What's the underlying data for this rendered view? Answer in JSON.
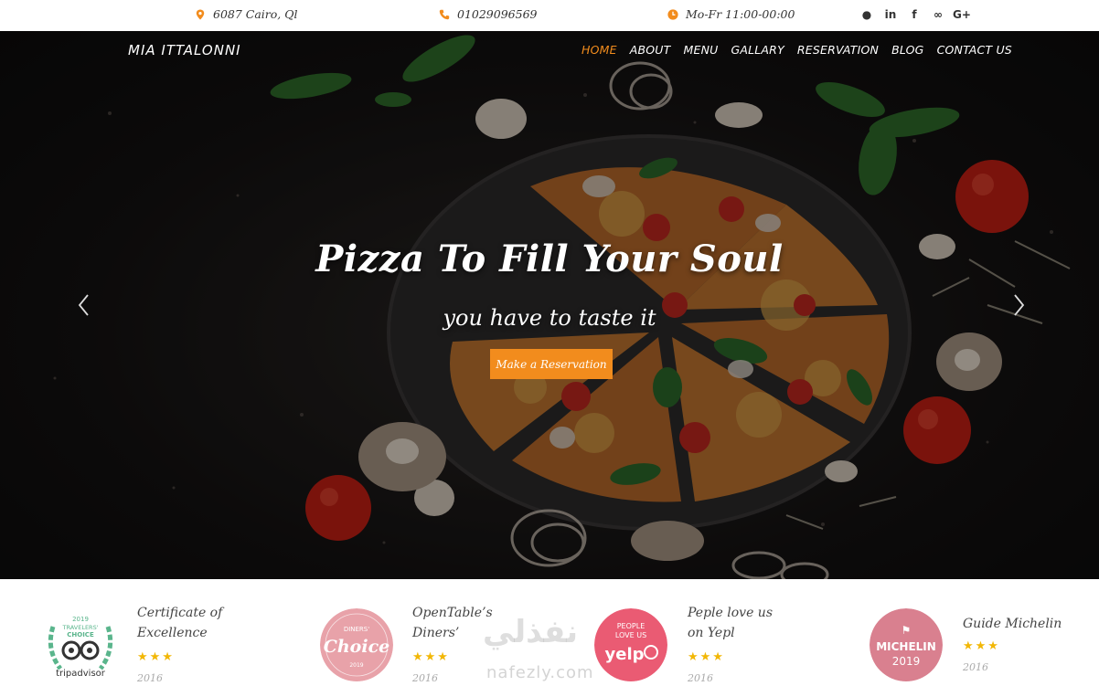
{
  "topbar": {
    "address": "6087 Cairo, Ql",
    "phone": "01029096569",
    "hours": "Mo-Fr 11:00-00:00",
    "socials": [
      "github-icon",
      "linkedin-icon",
      "facebook-icon",
      "tripadvisor-icon",
      "google-plus-icon"
    ],
    "social_glyphs": [
      "●",
      "in",
      "f",
      "∞",
      "G+"
    ],
    "icon_color": "#f28c1d"
  },
  "nav": {
    "brand": "MIA ITTALONNI",
    "items": [
      "HOME",
      "ABOUT",
      "MENU",
      "GALLARY",
      "RESERVATION",
      "BLOG",
      "CONTACT US"
    ],
    "active": "HOME",
    "active_color": "#f28c1d"
  },
  "hero": {
    "title": "Pizza To Fill Your Soul",
    "subtitle": "you have to taste it",
    "button": "Make a Reservation",
    "prev_arrow": "‹",
    "next_arrow": "›"
  },
  "awards": [
    {
      "title": "Certificate of Excellence",
      "badge": "tripadvisor-travelers-choice-badge",
      "badge_text": "tripadvisor",
      "stars": "★★★",
      "year": "2016"
    },
    {
      "title": "OpenTable’s Diners’",
      "badge": "diners-choice-badge",
      "badge_text": "Choice",
      "stars": "★★★",
      "year": "2016"
    },
    {
      "title": "Peple love us on Yepl",
      "badge": "yelp-badge",
      "badge_text": "yelp",
      "stars": "★★★",
      "year": "2016"
    },
    {
      "title": "Guide Michelin",
      "badge": "michelin-badge",
      "badge_text": "MICHELIN 2019",
      "stars": "★★★",
      "year": "2016"
    }
  ],
  "watermark": {
    "text": "نفذلي",
    "domain": "nafezly.com"
  }
}
